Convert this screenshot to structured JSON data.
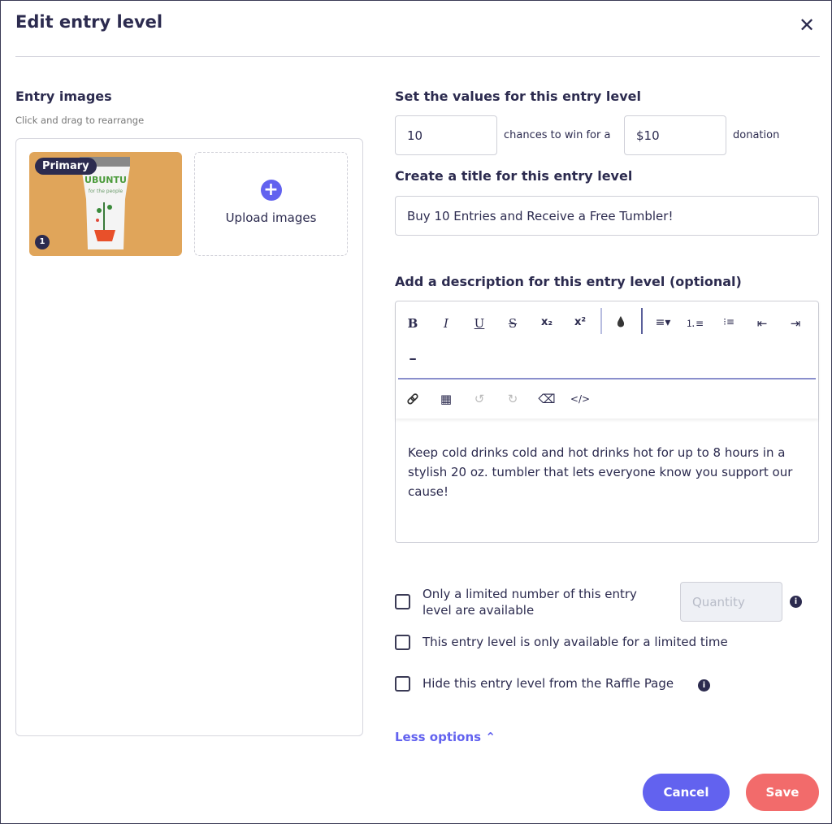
{
  "header": {
    "title": "Edit entry level",
    "close_icon": "close-icon"
  },
  "images": {
    "heading": "Entry images",
    "hint": "Click and drag to rearrange",
    "primary_badge": "Primary",
    "position": "1",
    "thumb_brand": "UBUNTU",
    "thumb_tagline": "for the people",
    "upload_label": "Upload images"
  },
  "values": {
    "heading": "Set the values for this entry level",
    "chances": "10",
    "chances_text": "chances to win for a",
    "donation": "$10",
    "donation_text": "donation"
  },
  "title_section": {
    "heading": "Create a title for this entry level",
    "value": "Buy 10 Entries and Receive a Free Tumbler!"
  },
  "description": {
    "heading": "Add a description for this entry level (optional)",
    "body": "Keep cold drinks cold and hot drinks hot for up to 8 hours in a stylish 20 oz. tumbler that lets everyone know you support our cause!",
    "toolbar": {
      "bold": "B",
      "italic": "I",
      "underline": "U",
      "strike": "S",
      "subscript": "x₂",
      "superscript": "x²",
      "color": "💧",
      "align": "≡▾",
      "ordered_list": "⒈≡",
      "bullet_list": "⁝≡",
      "outdent": "⇤",
      "indent": "⇥",
      "hr": "━",
      "link": "🔗",
      "table": "▦",
      "undo": "↺",
      "redo": "↻",
      "clear": "⌫",
      "code": "</>"
    }
  },
  "options": {
    "limited_qty": "Only a limited number of this entry level are available",
    "quantity_placeholder": "Quantity",
    "limited_time": "This entry level is only available for a limited time",
    "hide": "Hide this entry level from the Raffle Page",
    "info": "i",
    "less": "Less options",
    "less_icon": "chevron-up-icon"
  },
  "footer": {
    "cancel": "Cancel",
    "save": "Save"
  },
  "colors": {
    "primary": "#6262ef",
    "save": "#f26b6b",
    "text": "#2c2b4f"
  }
}
